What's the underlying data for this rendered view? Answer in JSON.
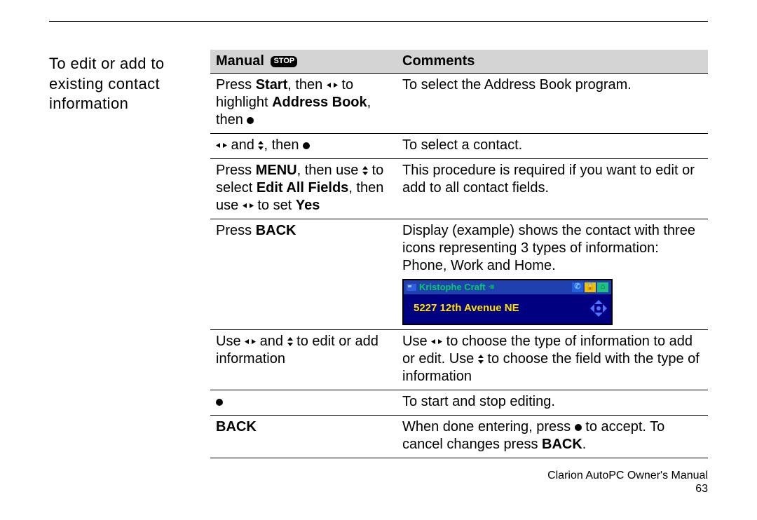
{
  "sideHeading": "To edit or add to existing contact information",
  "headers": {
    "manual": "Manual",
    "comments": "Comments",
    "stop": "STOP"
  },
  "rows": {
    "r1": {
      "m_a": "Press ",
      "m_b": "Start",
      "m_c": ", then ",
      "m_d": " to highlight ",
      "m_e": "Address Book",
      "m_f": ", then ",
      "c": "To select the Address Book program."
    },
    "r2": {
      "m_a": " and ",
      "m_b": ", then ",
      "c": "To select a contact."
    },
    "r3": {
      "m_a": "Press ",
      "m_b": "MENU",
      "m_c": ", then use ",
      "m_d": " to select ",
      "m_e": "Edit All Fields",
      "m_f": ", then use ",
      "m_g": " to set ",
      "m_h": "Yes",
      "c": "This procedure is required if you want to edit or add to all contact fields."
    },
    "r4": {
      "m_a": "Press ",
      "m_b": "BACK",
      "c": "Display (example) shows the contact with three icons representing 3 types of information: Phone, Work and Home."
    },
    "r5": {
      "m_a": "Use ",
      "m_b": " and ",
      "m_c": " to edit or add information",
      "c_a": "Use ",
      "c_b": " to choose the type of information to add or edit.  Use ",
      "c_c": " to choose the field with the type of information"
    },
    "r6": {
      "c": "To start and stop editing."
    },
    "r7": {
      "m": "BACK",
      "c_a": "When done entering, press ",
      "c_b": " to accept. To cancel changes press ",
      "c_c": "BACK",
      "c_d": "."
    }
  },
  "lcd": {
    "name": "Kristophe Craft",
    "address": "5227 12th Avenue NE"
  },
  "footer": {
    "line1": "Clarion AutoPC Owner's Manual",
    "line2": "63"
  }
}
